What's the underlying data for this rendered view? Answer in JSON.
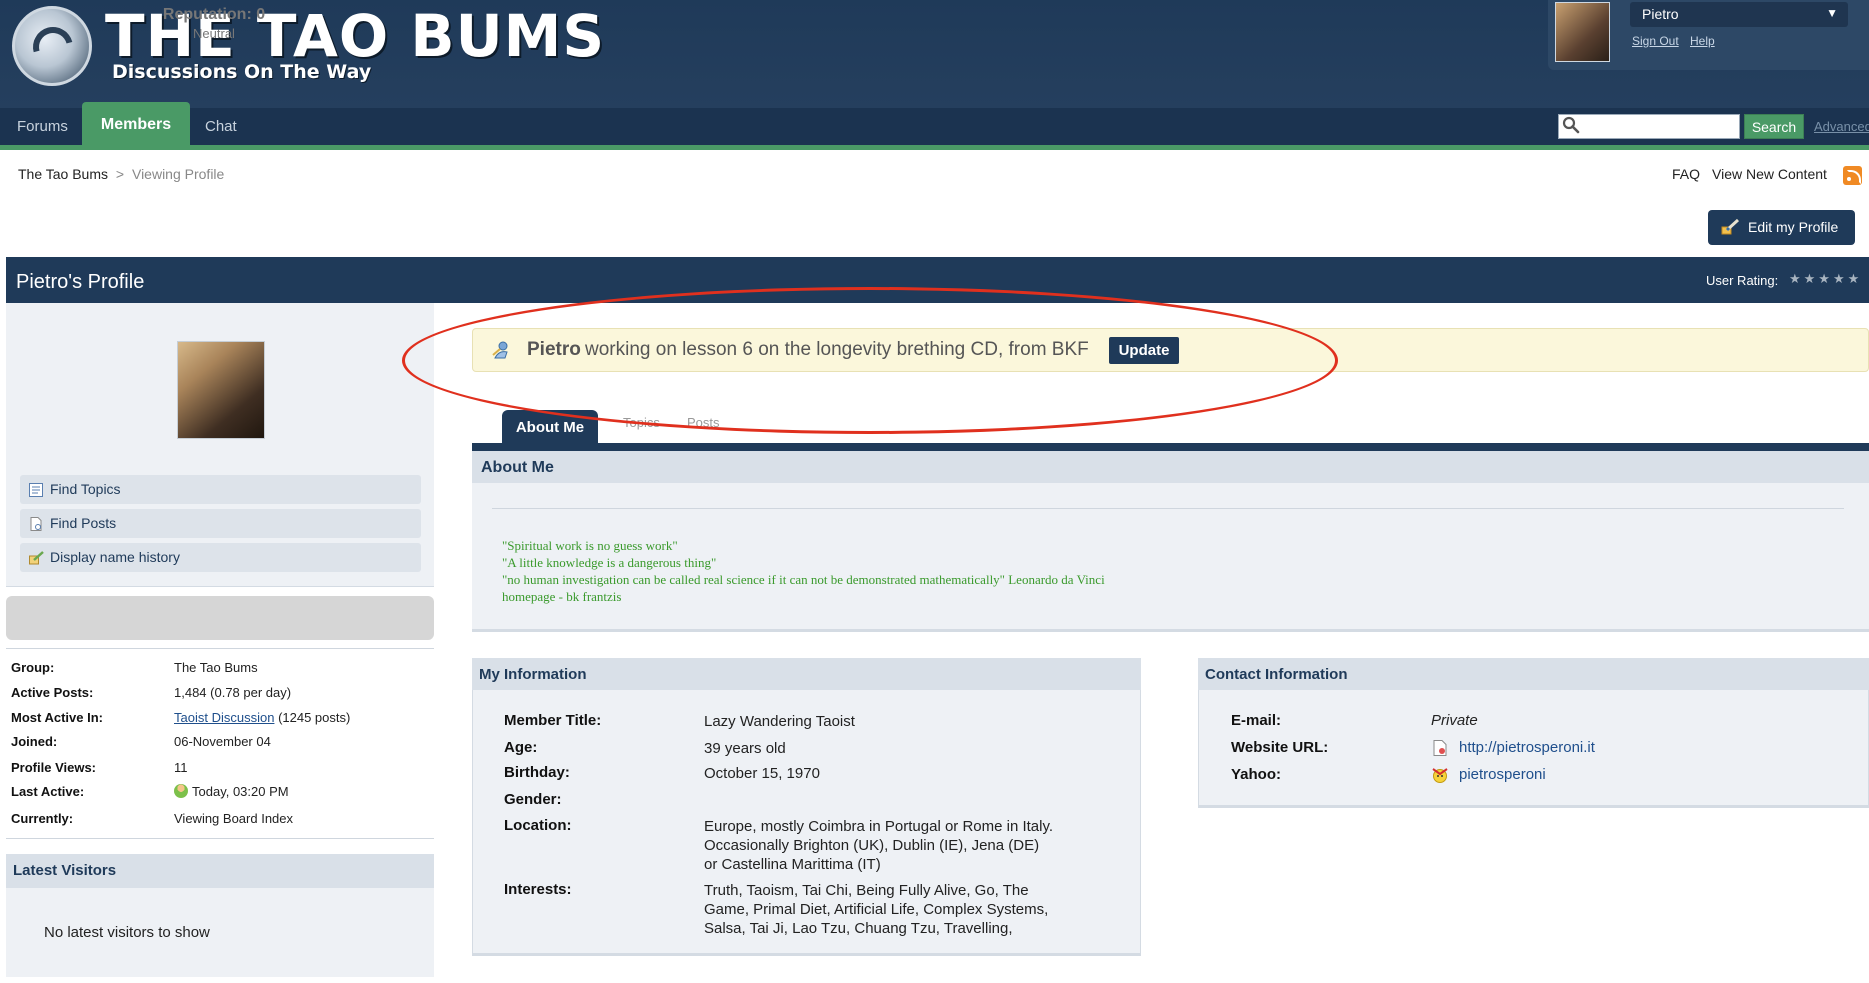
{
  "header": {
    "site_title": "THE TAO BUMS",
    "tagline": "Discussions On The Way",
    "user_name": "Pietro",
    "sign_out": "Sign Out",
    "help": "Help"
  },
  "nav": {
    "tabs": [
      {
        "label": "Forums"
      },
      {
        "label": "Members",
        "active": true
      },
      {
        "label": "Chat"
      }
    ],
    "search_placeholder": "",
    "search_button": "Search",
    "advanced": "Advanced"
  },
  "breadcrumb": {
    "root": "The Tao Bums",
    "separator": ">",
    "current": "Viewing Profile"
  },
  "toplinks": {
    "faq": "FAQ",
    "new_content": "View New Content"
  },
  "edit_profile": "Edit my Profile",
  "profile": {
    "title": "Pietro's Profile",
    "rating_label": "User Rating:",
    "rating_stars": "★★★★★"
  },
  "sidebar": {
    "buttons": [
      {
        "label": "Find Topics"
      },
      {
        "label": "Find Posts"
      },
      {
        "label": "Display name history"
      }
    ],
    "reputation_title": "Reputation: 0",
    "reputation_sub": "Neutral",
    "info": [
      {
        "label": "Group:",
        "value": "The Tao Bums"
      },
      {
        "label": "Active Posts:",
        "value": "1,484 (0.78 per day)"
      },
      {
        "label": "Most Active In:",
        "link": "Taoist Discussion",
        "suffix": "(1245 posts)"
      },
      {
        "label": "Joined:",
        "value": "06-November 04"
      },
      {
        "label": "Profile Views:",
        "value": "11"
      },
      {
        "label": "Last Active:",
        "value": "Today, 03:20 PM"
      },
      {
        "label": "Currently:",
        "value": "Viewing Board Index"
      }
    ],
    "visitors_title": "Latest Visitors",
    "visitors_empty": "No latest visitors to show"
  },
  "status": {
    "name": "Pietro",
    "text": "working on lesson 6 on the longevity brething CD, from BKF",
    "update_button": "Update"
  },
  "tabs": [
    {
      "label": "About Me",
      "active": true
    },
    {
      "label": "Topics"
    },
    {
      "label": "Posts"
    }
  ],
  "about": {
    "title": "About Me",
    "lines": [
      "\"Spiritual work is no guess work\"",
      "\"A little knowledge is a dangerous thing\"",
      "\"no human investigation can be called real science if it can not be demonstrated mathematically\" Leonardo da Vinci",
      "homepage - bk frantzis"
    ]
  },
  "my_info": {
    "title": "My Information",
    "rows": [
      {
        "label": "Member Title:",
        "value": "Lazy Wandering Taoist"
      },
      {
        "label": "Age:",
        "value": "39 years old"
      },
      {
        "label": "Birthday:",
        "value": "October 15, 1970"
      },
      {
        "label": "Gender:",
        "value": ""
      },
      {
        "label": "Location:",
        "value_lines": [
          "Europe, mostly Coimbra in Portugal or Rome in Italy.",
          "Occasionally Brighton (UK), Dublin (IE), Jena (DE)",
          "or Castellina Marittima (IT)"
        ]
      },
      {
        "label": "Interests:",
        "value_lines": [
          "Truth, Taoism, Tai Chi, Being Fully Alive, Go, The",
          "Game, Primal Diet, Artificial Life, Complex Systems,",
          "Salsa, Tai Ji, Lao Tzu, Chuang Tzu, Travelling,"
        ]
      }
    ]
  },
  "contact_info": {
    "title": "Contact Information",
    "rows": [
      {
        "label": "E-mail:",
        "value": "Private"
      },
      {
        "label": "Website URL:",
        "value": "http://pietrosperoni.it"
      },
      {
        "label": "Yahoo:",
        "value": "pietrosperoni"
      }
    ]
  },
  "colors": {
    "header_navy": "#1f3a59",
    "accent_green": "#4a9a66",
    "quote_green": "#3a9a2c",
    "annotation_red": "#e0301e"
  }
}
